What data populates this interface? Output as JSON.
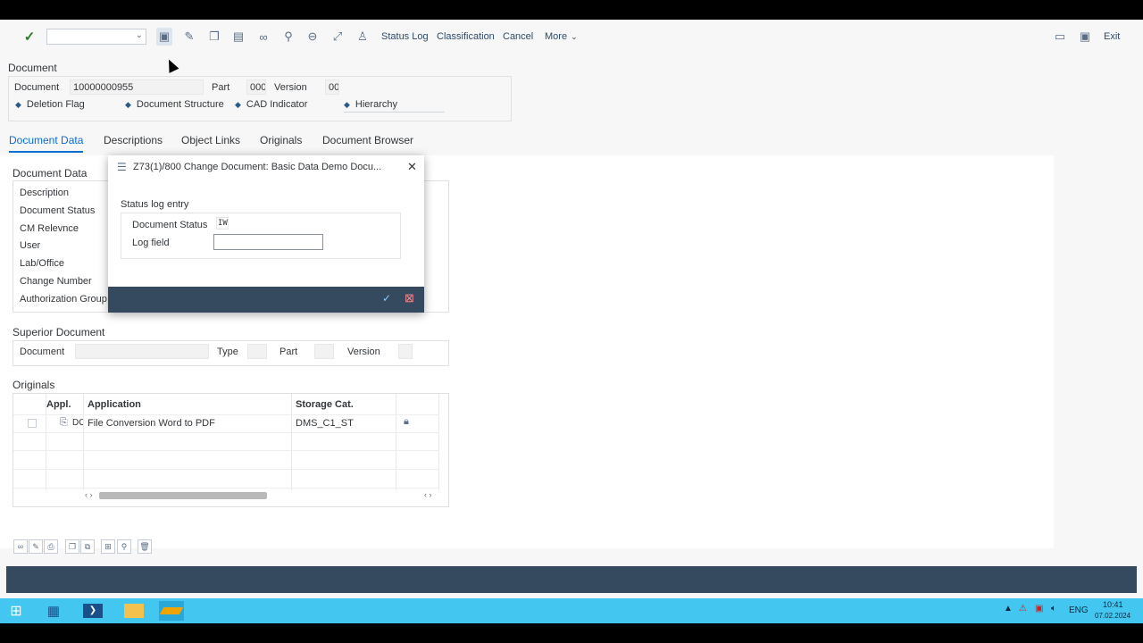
{
  "toolbar": {
    "status_log": "Status Log",
    "classification": "Classification",
    "cancel": "Cancel",
    "more": "More",
    "exit": "Exit"
  },
  "document_header": {
    "section_title": "Document",
    "document_label": "Document",
    "document_value": "10000000955",
    "part_label": "Part",
    "part_value": "000",
    "version_label": "Version",
    "version_value": "00",
    "deletion_flag": "Deletion Flag",
    "document_structure": "Document Structure",
    "cad_indicator": "CAD Indicator",
    "hierarchy": "Hierarchy"
  },
  "tabs": [
    "Document Data",
    "Descriptions",
    "Object Links",
    "Originals",
    "Document Browser"
  ],
  "document_data": {
    "title": "Document Data",
    "fields": [
      "Description",
      "Document Status",
      "CM Relevnce",
      "User",
      "Lab/Office",
      "Change Number",
      "Authorization Group"
    ]
  },
  "superior_document": {
    "title": "Superior Document",
    "document_label": "Document",
    "type_label": "Type",
    "part_label": "Part",
    "version_label": "Version"
  },
  "originals": {
    "title": "Originals",
    "columns": [
      "Appl.",
      "Application",
      "Storage Cat."
    ],
    "rows": [
      {
        "appl": "DO",
        "application": "File Conversion Word to PDF",
        "storage": "DMS_C1_ST"
      }
    ]
  },
  "dialog": {
    "title": "Z73(1)/800 Change Document: Basic Data Demo Docu...",
    "section": "Status log entry",
    "status_label": "Document Status",
    "status_value": "IW",
    "log_label": "Log field",
    "log_value": ""
  },
  "taskbar": {
    "lang": "ENG",
    "time": "10:41",
    "date": "07.02.2024"
  }
}
